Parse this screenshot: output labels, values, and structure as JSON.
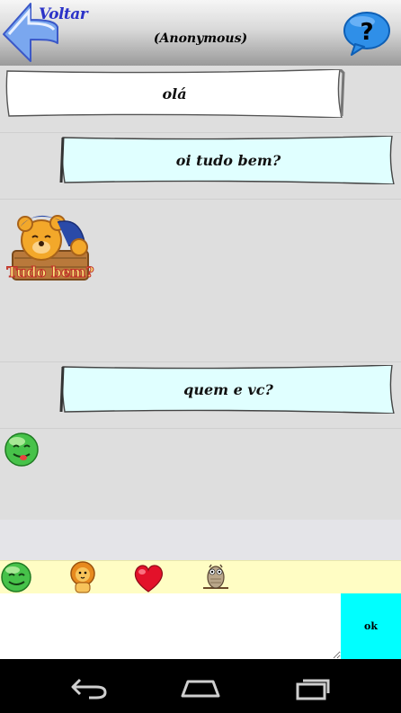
{
  "header": {
    "back_label": "Voltar",
    "title": "(Anonymous)"
  },
  "messages": [
    {
      "text": "olá"
    },
    {
      "text": "oi tudo bem?"
    },
    {
      "sticker": "bear-sticker",
      "text": "Tudo bem?"
    },
    {
      "text": "quem e vc?"
    },
    {
      "sticker": "smiley-tongue-sticker"
    }
  ],
  "emoji_bar": [
    "smiley-icon",
    "lion-icon",
    "heart-icon",
    "owl-icon"
  ],
  "input": {
    "value": "",
    "placeholder": ""
  },
  "ok_label": "ok",
  "colors": {
    "received_bubble": "#ffffff",
    "sent_bubble": "#e0ffff",
    "ok_button": "#00ffff",
    "emoji_bar": "#fffdc4"
  }
}
